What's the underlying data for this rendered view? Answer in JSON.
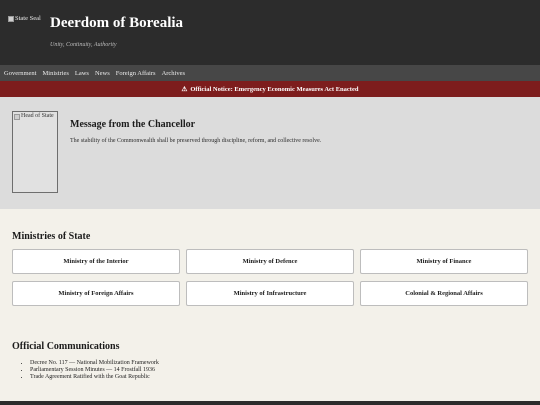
{
  "header": {
    "seal_alt": "State Seal",
    "title": "Deerdom of Borealia",
    "motto": "Unity, Continuity, Authority"
  },
  "nav": {
    "items": [
      "Government",
      "Ministries",
      "Laws",
      "News",
      "Foreign Affairs",
      "Archives"
    ]
  },
  "notice": {
    "icon": "⚠",
    "text": "Official Notice: Emergency Economic Measures Act Enacted"
  },
  "message": {
    "portrait_alt": "Head of State",
    "title": "Message from the Chancellor",
    "body": "The stability of the Commonwealth shall be preserved through discipline, reform, and collective resolve."
  },
  "ministries": {
    "heading": "Ministries of State",
    "items": [
      "Ministry of the Interior",
      "Ministry of Defence",
      "Ministry of Finance",
      "Ministry of Foreign Affairs",
      "Ministry of Infrastructure",
      "Colonial & Regional Affairs"
    ]
  },
  "communications": {
    "heading": "Official Communications",
    "items": [
      "Decree No. 117 — National Mobilization Framework",
      "Parliamentary Session Minutes — 14 Frostfall 1936",
      "Trade Agreement Ratified with the Goat Republic"
    ]
  },
  "colors": {
    "header_bg": "#2c2c2c",
    "nav_bg": "#474747",
    "notice_bg": "#7d1d1d",
    "message_bg": "#dcdcdc",
    "page_bg": "#f3f1ea"
  }
}
